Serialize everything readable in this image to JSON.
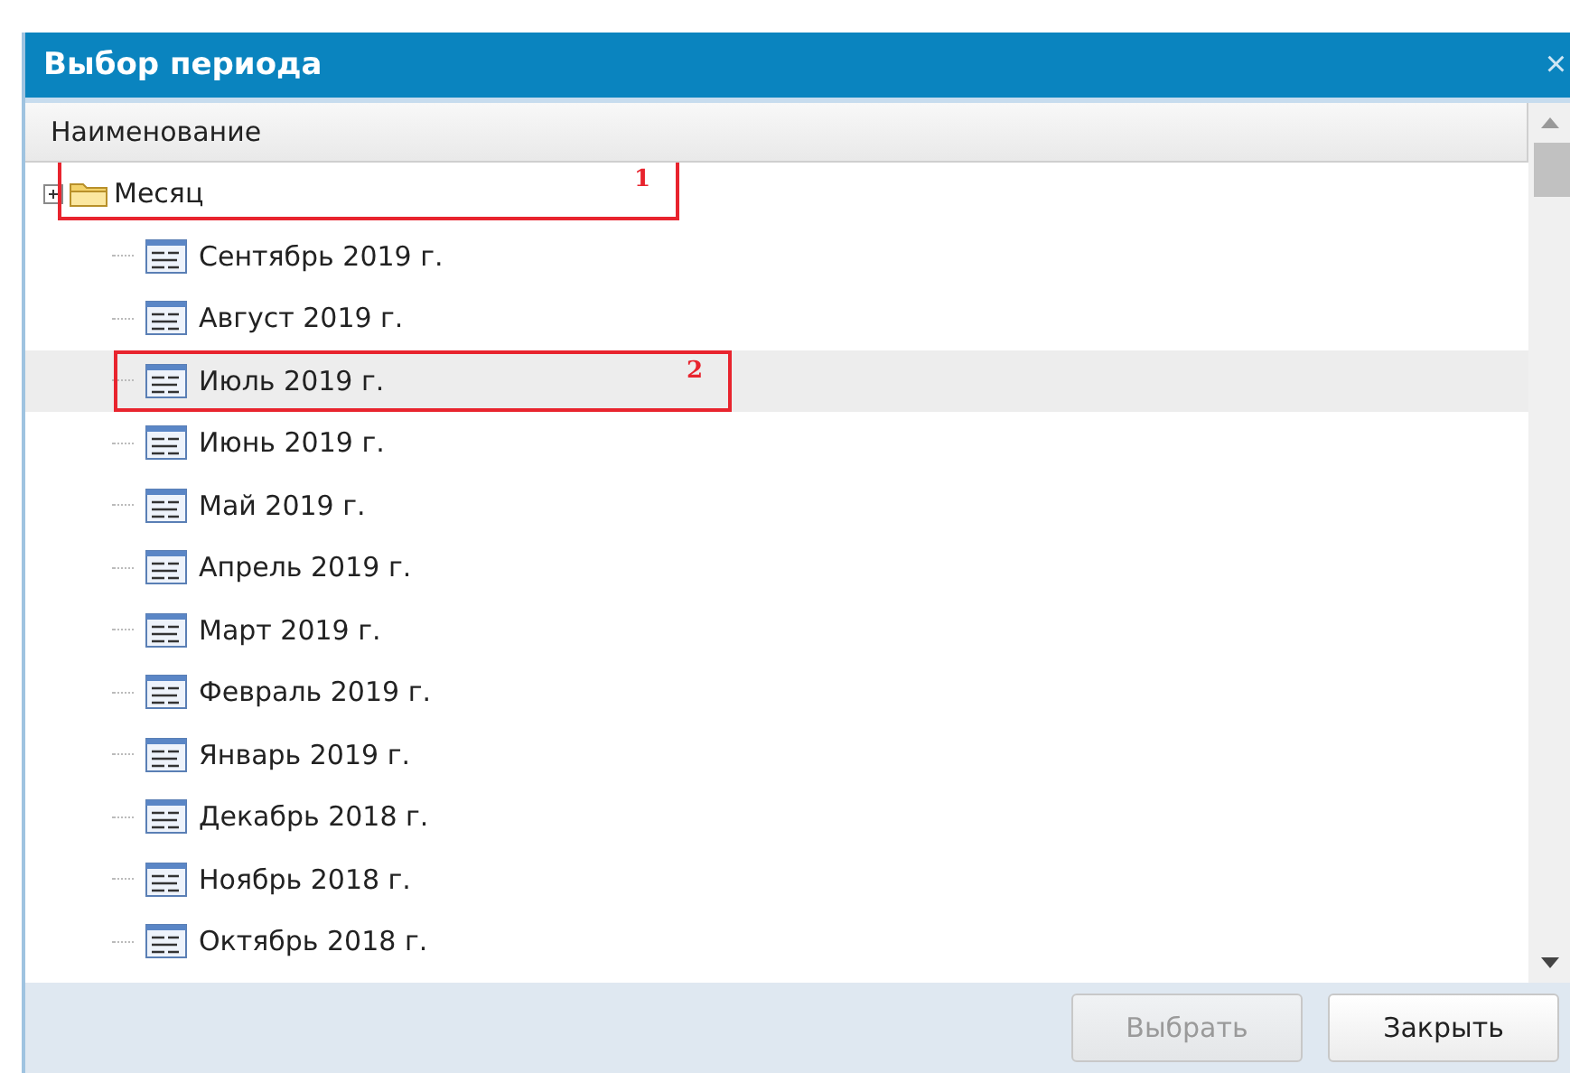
{
  "window": {
    "title": "Выбор периода",
    "close": "×"
  },
  "table": {
    "columns": [
      "Наименование"
    ]
  },
  "tree": {
    "label": "Месяц",
    "callout": "1",
    "children": [
      {
        "label": "Сентябрь 2019 г.",
        "selected": false
      },
      {
        "label": "Август 2019 г.",
        "selected": false
      },
      {
        "label": "Июль 2019 г.",
        "selected": true,
        "callout": "2"
      },
      {
        "label": "Июнь 2019 г.",
        "selected": false
      },
      {
        "label": "Май 2019 г.",
        "selected": false
      },
      {
        "label": "Апрель 2019 г.",
        "selected": false
      },
      {
        "label": "Март 2019 г.",
        "selected": false
      },
      {
        "label": "Февраль 2019 г.",
        "selected": false
      },
      {
        "label": "Январь 2019 г.",
        "selected": false
      },
      {
        "label": "Декабрь 2018 г.",
        "selected": false
      },
      {
        "label": "Ноябрь 2018 г.",
        "selected": false
      },
      {
        "label": "Октябрь 2018 г.",
        "selected": false
      }
    ]
  },
  "buttons": [
    {
      "label": "Выбрать",
      "disabled": true
    },
    {
      "label": "Закрыть",
      "disabled": false
    }
  ]
}
